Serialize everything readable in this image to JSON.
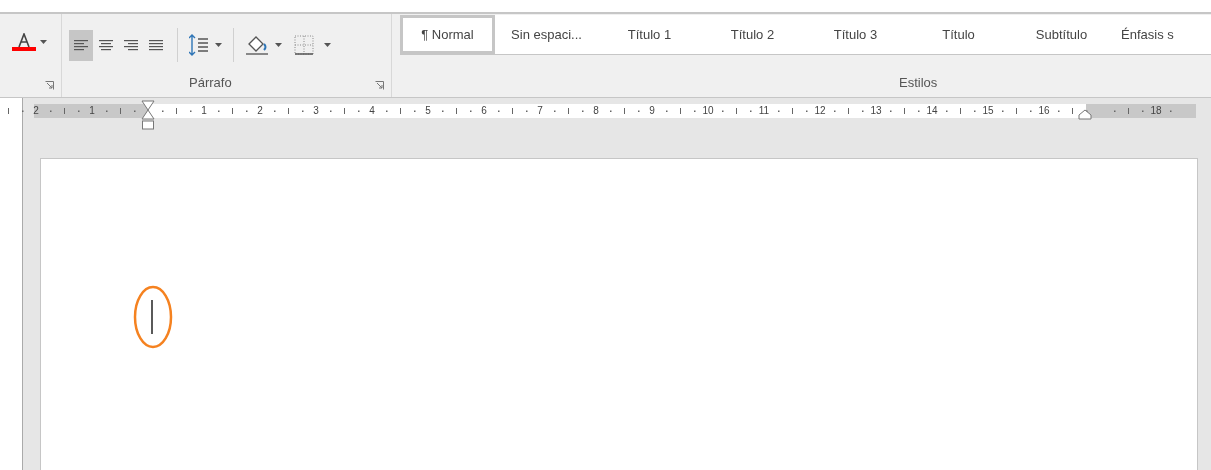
{
  "ribbon": {
    "paragraph_group": {
      "label": "Párrafo",
      "alignments": [
        {
          "kind": "left",
          "selected": true
        },
        {
          "kind": "center",
          "selected": false
        },
        {
          "kind": "right",
          "selected": false
        },
        {
          "kind": "justify",
          "selected": false
        }
      ]
    },
    "styles_group": {
      "label": "Estilos",
      "styles": [
        {
          "label": "¶ Normal",
          "selected": true
        },
        {
          "label": "Sin espaci...",
          "selected": false
        },
        {
          "label": "Título 1",
          "selected": false
        },
        {
          "label": "Título 2",
          "selected": false
        },
        {
          "label": "Título 3",
          "selected": false
        },
        {
          "label": "Título",
          "selected": false
        },
        {
          "label": "Subtítulo",
          "selected": false
        },
        {
          "label": "Énfasis s",
          "selected": false
        }
      ]
    }
  },
  "ruler": {
    "left_labels": [
      "2",
      "1"
    ],
    "labels": [
      "1",
      "2",
      "3",
      "4",
      "5",
      "6",
      "7",
      "8",
      "9",
      "10",
      "11",
      "12",
      "13",
      "14",
      "15",
      "16"
    ],
    "right_labels": [
      "18"
    ]
  },
  "document": {
    "highlight": {
      "color": "#f58220"
    }
  }
}
